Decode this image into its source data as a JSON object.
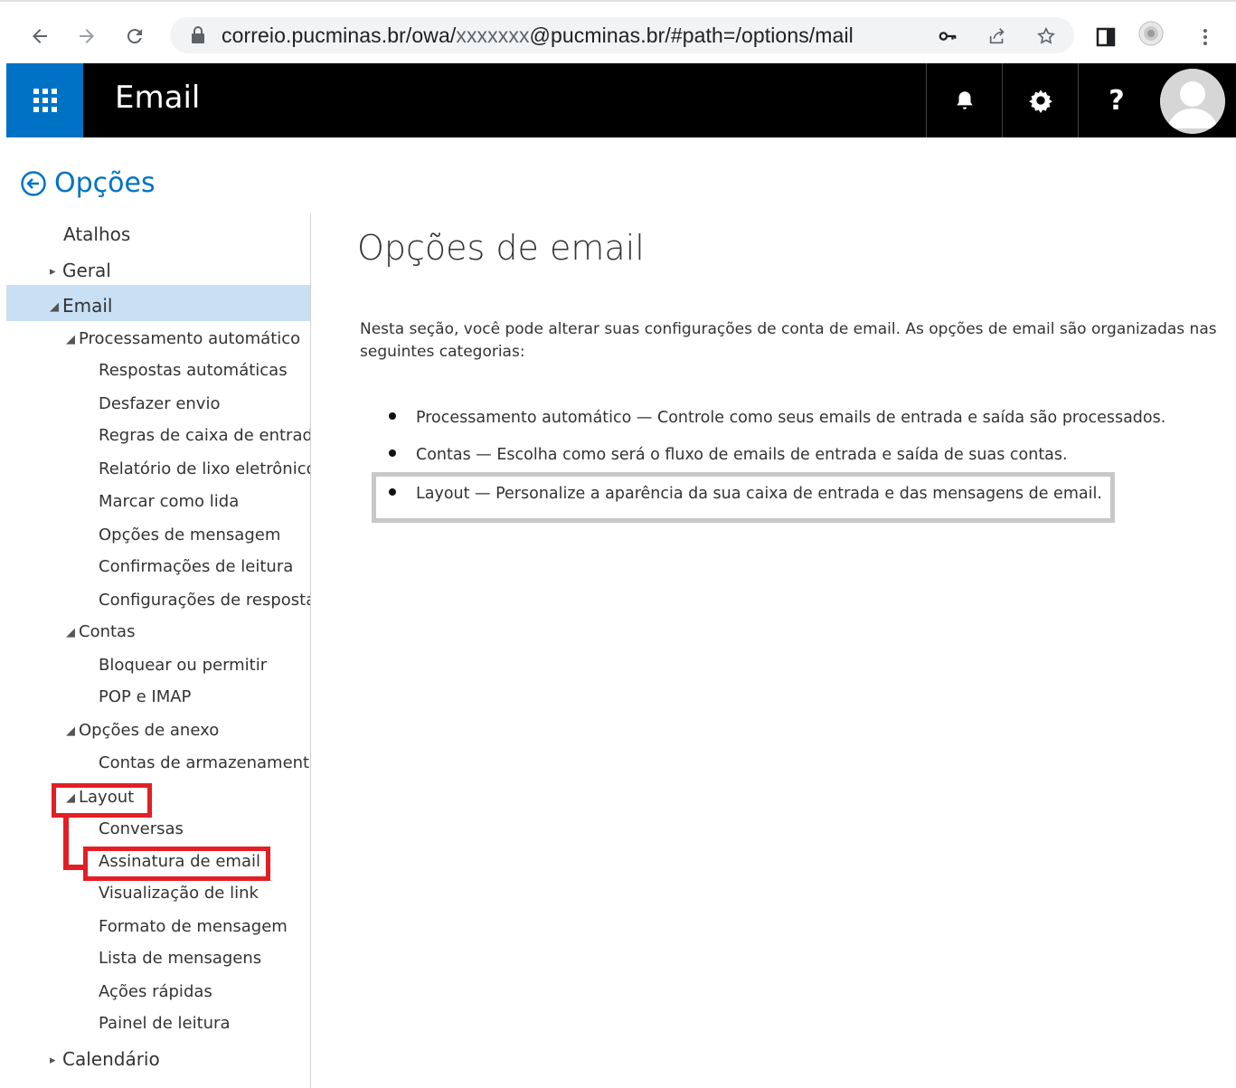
{
  "browser": {
    "url_prefix": "correio.pucminas.br/owa/",
    "url_masked": "xxxxxxx",
    "url_suffix": "@pucminas.br/#path=/options/mail"
  },
  "owa": {
    "app_title": "Email"
  },
  "options_header": "Opções",
  "nav": {
    "items": [
      {
        "label": "Atalhos",
        "level": 0,
        "arrow": ""
      },
      {
        "label": "Geral",
        "level": 0,
        "arrow": "collapsed"
      },
      {
        "label": "Email",
        "level": 0,
        "arrow": "expanded",
        "selected": true
      },
      {
        "label": "Processamento automático",
        "level": 1,
        "arrow": "expanded"
      },
      {
        "label": "Respostas automáticas",
        "level": 2,
        "arrow": ""
      },
      {
        "label": "Desfazer envio",
        "level": 2,
        "arrow": ""
      },
      {
        "label": "Regras de caixa de entrada",
        "level": 2,
        "arrow": ""
      },
      {
        "label": "Relatório de lixo eletrônico",
        "level": 2,
        "arrow": ""
      },
      {
        "label": "Marcar como lida",
        "level": 2,
        "arrow": ""
      },
      {
        "label": "Opções de mensagem",
        "level": 2,
        "arrow": ""
      },
      {
        "label": "Confirmações de leitura",
        "level": 2,
        "arrow": ""
      },
      {
        "label": "Configurações de resposta",
        "level": 2,
        "arrow": ""
      },
      {
        "label": "Contas",
        "level": 1,
        "arrow": "expanded"
      },
      {
        "label": "Bloquear ou permitir",
        "level": 2,
        "arrow": ""
      },
      {
        "label": "POP e IMAP",
        "level": 2,
        "arrow": ""
      },
      {
        "label": "Opções de anexo",
        "level": 1,
        "arrow": "expanded"
      },
      {
        "label": "Contas de armazenamento",
        "level": 2,
        "arrow": ""
      },
      {
        "label": "Layout",
        "level": 1,
        "arrow": "expanded"
      },
      {
        "label": "Conversas",
        "level": 2,
        "arrow": ""
      },
      {
        "label": "Assinatura de email",
        "level": 2,
        "arrow": ""
      },
      {
        "label": "Visualização de link",
        "level": 2,
        "arrow": ""
      },
      {
        "label": "Formato de mensagem",
        "level": 2,
        "arrow": ""
      },
      {
        "label": "Lista de mensagens",
        "level": 2,
        "arrow": ""
      },
      {
        "label": "Ações rápidas",
        "level": 2,
        "arrow": ""
      },
      {
        "label": "Painel de leitura",
        "level": 2,
        "arrow": ""
      },
      {
        "label": "Calendário",
        "level": 0,
        "arrow": "collapsed"
      }
    ]
  },
  "main": {
    "title": "Opções de email",
    "intro": "Nesta seção, você pode alterar suas configurações de conta de email. As opções de email são organizadas nas seguintes categorias:",
    "bullets": [
      "Processamento automático — Controle como seus emails de entrada e saída são processados.",
      "Contas — Escolha como será o fluxo de emails de entrada e saída de suas contas.",
      "Layout — Personalize a aparência da sua caixa de entrada e das mensagens de email."
    ]
  },
  "colors": {
    "owa_blue": "#0072c6",
    "header_black": "#000000",
    "selected_bg": "#c8dff4",
    "annotation_red": "#e31e24",
    "annotation_gray": "#c8c8c8"
  },
  "icons": [
    "back-arrow-icon",
    "forward-arrow-icon",
    "reload-icon",
    "lock-icon",
    "key-icon",
    "share-icon",
    "star-icon",
    "sidepanel-icon",
    "extension-icon",
    "kebab-menu-icon",
    "waffle-icon",
    "bell-icon",
    "gear-icon",
    "help-icon",
    "avatar-icon",
    "back-circle-icon"
  ]
}
